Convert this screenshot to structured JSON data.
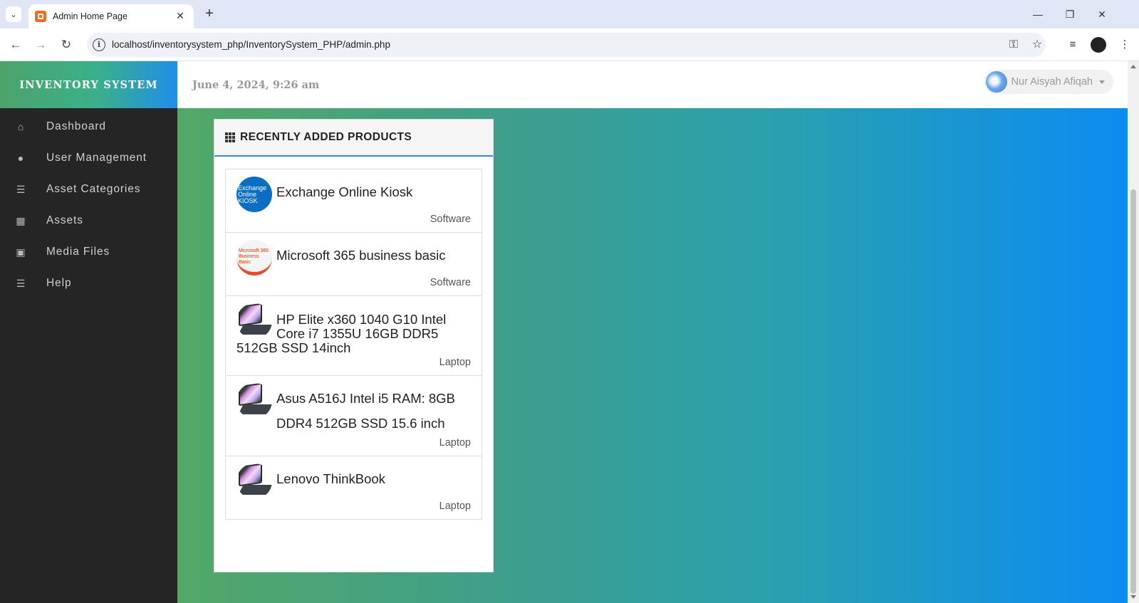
{
  "browser": {
    "tab_title": "Admin Home Page",
    "url": "localhost/inventorysystem_php/InventorySystem_PHP/admin.php"
  },
  "app": {
    "brand": "INVENTORY SYSTEM",
    "datetime": "June 4, 2024, 9:26 am",
    "user_name": "Nur Aisyah Afiqah",
    "colors": {
      "sidebar_bg": "#252525",
      "accent_blue": "#2f8ce0",
      "brand_green": "#4ca36b"
    }
  },
  "sidebar": {
    "items": [
      {
        "label": "Dashboard",
        "icon": "home-icon"
      },
      {
        "label": "User Management",
        "icon": "user-icon"
      },
      {
        "label": "Asset Categories",
        "icon": "indent-icon"
      },
      {
        "label": "Assets",
        "icon": "grid-icon"
      },
      {
        "label": "Media Files",
        "icon": "picture-icon"
      },
      {
        "label": "Help",
        "icon": "indent-icon"
      }
    ]
  },
  "panel": {
    "title": "RECENTLY ADDED PRODUCTS",
    "products": [
      {
        "name": "Exchange Online Kiosk",
        "category": "Software",
        "thumb_text": "Exchange Online KIOSK"
      },
      {
        "name": "Microsoft 365 business basic",
        "category": "Software",
        "thumb_text": "Microsoft 365 Business Basic"
      },
      {
        "name": "HP Elite x360 1040 G10 Intel Core i7 1355U 16GB DDR5 512GB SSD 14inch",
        "category": "Laptop"
      },
      {
        "name": "Asus A516J Intel i5 RAM: 8GB DDR4 512GB SSD 15.6 inch",
        "category": "Laptop"
      },
      {
        "name": "Lenovo ThinkBook",
        "category": "Laptop"
      }
    ]
  }
}
